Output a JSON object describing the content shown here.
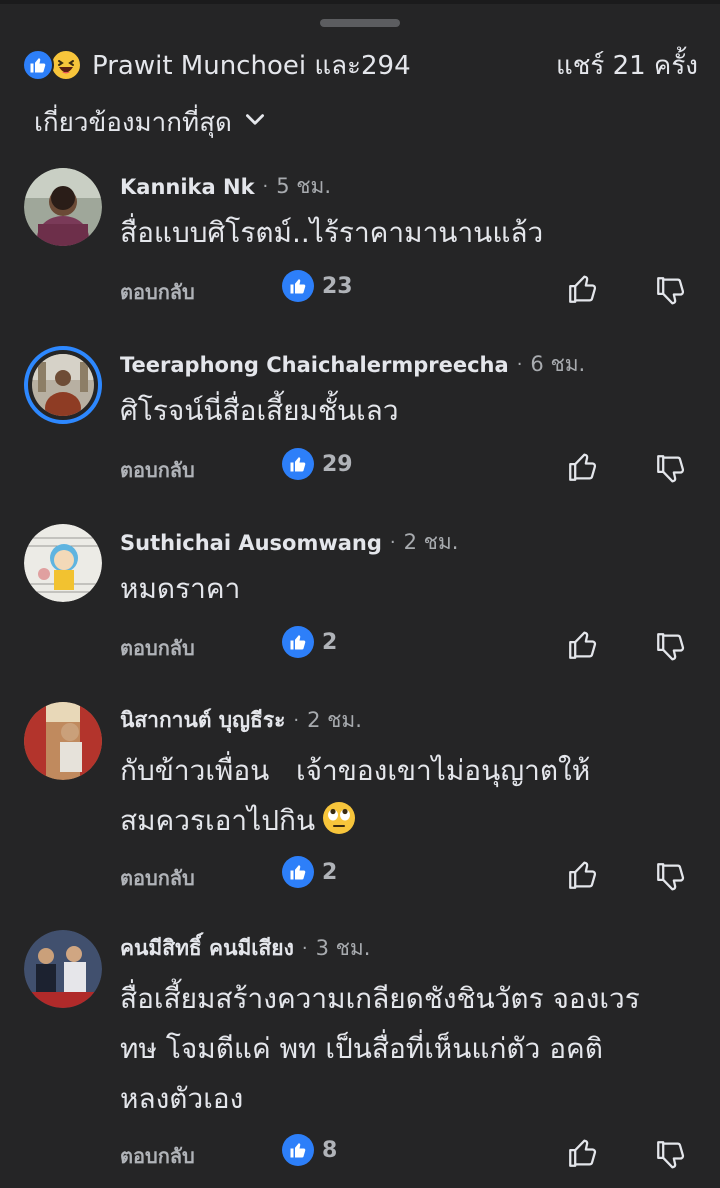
{
  "header": {
    "reactors_text": "Prawit Munchoei และ294",
    "shares_text": "แชร์ 21 ครั้ง",
    "reaction_icons": [
      "like-icon",
      "haha-icon"
    ]
  },
  "sort": {
    "label": "เกี่ยวข้องมากที่สุด",
    "icon": "chevron-down-icon"
  },
  "comments": [
    {
      "name": "Kannika Nk",
      "time": "5 ชม.",
      "text_lines": [
        "สื่อแบบศิโรตม์..ไร้ราคามานานแล้ว"
      ],
      "reply_label": "ตอบกลับ",
      "like_count": "23",
      "avatar_color": "#7a6a58"
    },
    {
      "name": "Teeraphong Chaichalermpreecha",
      "time": "6 ชม.",
      "text_lines": [
        "ศิโรจน์นี่สื่อเสี้ยมชั้นเลว"
      ],
      "reply_label": "ตอบกลับ",
      "like_count": "29",
      "avatar_color": "#8e7c66"
    },
    {
      "name": "Suthichai Ausomwang",
      "time": "2 ชม.",
      "text_lines": [
        "หมดราคา"
      ],
      "reply_label": "ตอบกลับ",
      "like_count": "2",
      "avatar_color": "#e8e6e0"
    },
    {
      "name": "นิสากานต์ บุญธีระ",
      "time": "2 ชม.",
      "text_lines": [
        "กับข้าวเพื่อน   เจ้าของเขาไม่อนุญาตให้",
        "สมควรเอาไปกิน"
      ],
      "trailing_emoji": "face-with-rolling-eyes",
      "reply_label": "ตอบกลับ",
      "like_count": "2",
      "avatar_color": "#b0443a"
    },
    {
      "name": "คนมีสิทธิ์ คนมีเสียง",
      "time": "3 ชม.",
      "text_lines": [
        "สื่อเสี้ยมสร้างความเกลียดชังชินวัตร จองเวร",
        "ทษ โจมตีแค่ พท เป็นสื่อที่เห็นแก่ตัว อคติ",
        "หลงตัวเอง"
      ],
      "reply_label": "ตอบกลับ",
      "like_count": "8",
      "avatar_color": "#3a4660"
    }
  ],
  "colors": {
    "background": "#252526",
    "text": "#e4e6eb",
    "muted": "#a8abaf",
    "like_blue": "#2d7ff9"
  }
}
